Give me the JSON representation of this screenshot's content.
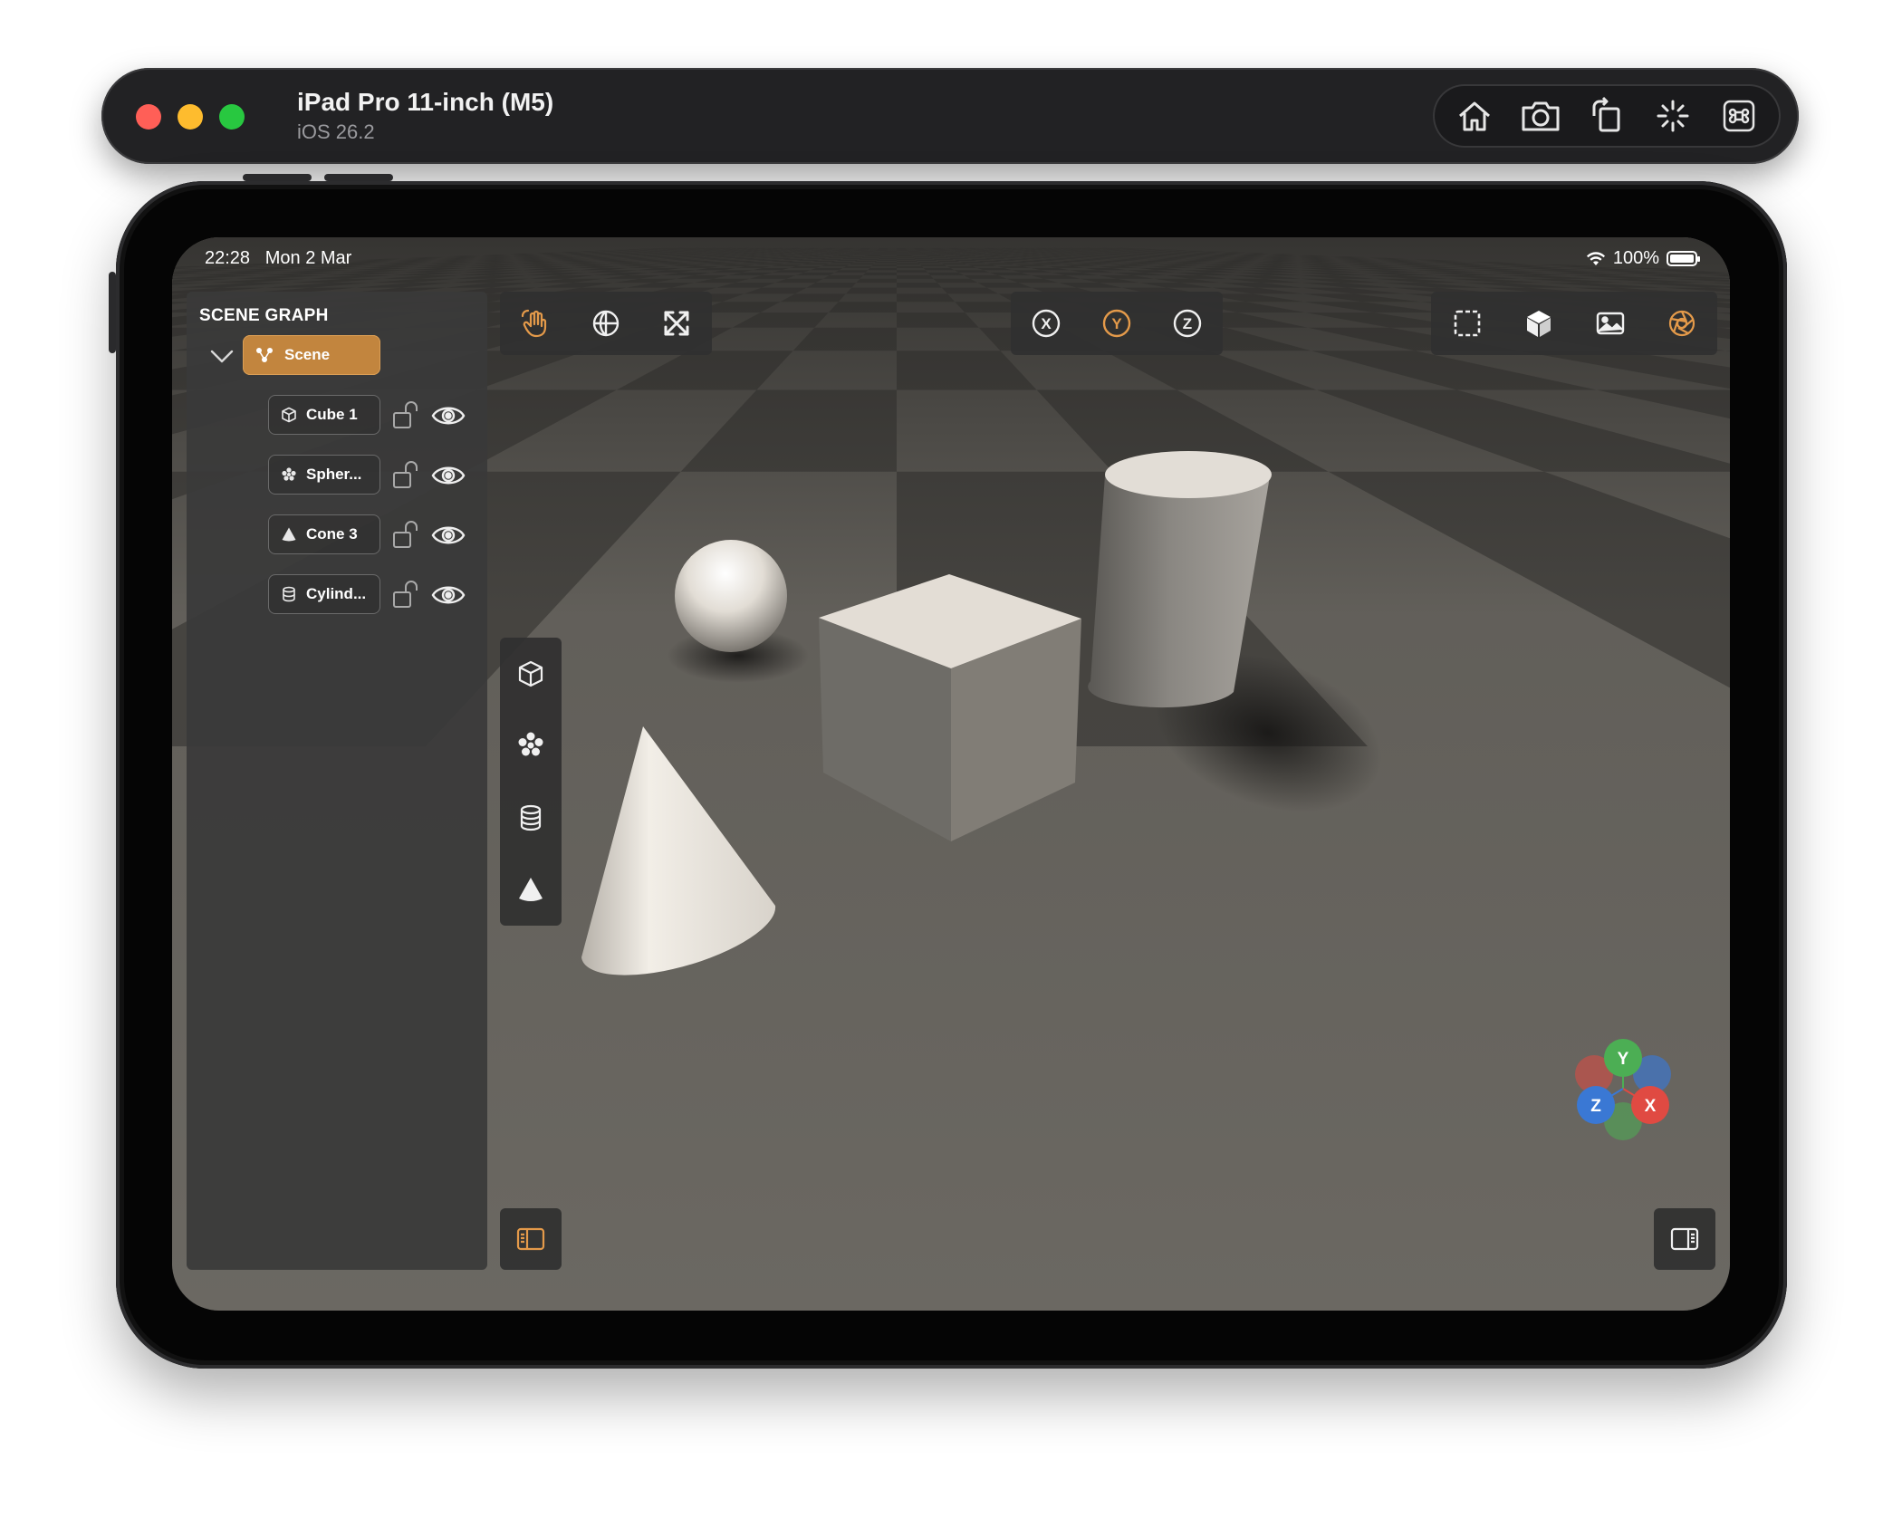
{
  "simulator": {
    "device_name": "iPad Pro 11-inch (M5)",
    "os_version": "iOS 26.2",
    "toolbar_icons": [
      "home-icon",
      "screenshot-icon",
      "rotate-icon",
      "shake-icon",
      "command-icon"
    ]
  },
  "status_bar": {
    "time": "22:28",
    "date": "Mon 2 Mar",
    "battery": "100%"
  },
  "scene_graph": {
    "title": "SCENE GRAPH",
    "root": {
      "label": "Scene",
      "icon": "scene-node-icon",
      "expanded": true
    },
    "items": [
      {
        "label": "Cube 1",
        "icon": "cube-icon",
        "locked": false,
        "visible": true
      },
      {
        "label": "Spher...",
        "icon": "sphere-icon",
        "locked": false,
        "visible": true
      },
      {
        "label": "Cone 3",
        "icon": "cone-icon",
        "locked": false,
        "visible": true
      },
      {
        "label": "Cylind...",
        "icon": "cylinder-icon",
        "locked": false,
        "visible": true
      }
    ]
  },
  "toolbars": {
    "transform": {
      "tools": [
        "move-hand-icon",
        "rotate-globe-icon",
        "scale-arrows-icon"
      ],
      "active": "move-hand-icon"
    },
    "axis": {
      "axes": [
        "X",
        "Y",
        "Z"
      ],
      "active": "Y"
    },
    "view": {
      "tools": [
        "selection-frame-icon",
        "solid-cube-icon",
        "image-icon",
        "aperture-icon"
      ],
      "active": "aperture-icon"
    },
    "add_shapes": {
      "tools": [
        "add-cube-icon",
        "add-sphere-icon",
        "add-cylinder-icon",
        "add-cone-icon"
      ]
    }
  },
  "gizmo": {
    "y_label": "Y",
    "z_label": "Z",
    "x_label": "X"
  },
  "colors": {
    "accent": "#c2853e",
    "axis_x": "#e04a42",
    "axis_y": "#4cae54",
    "axis_z": "#3a78d4"
  }
}
